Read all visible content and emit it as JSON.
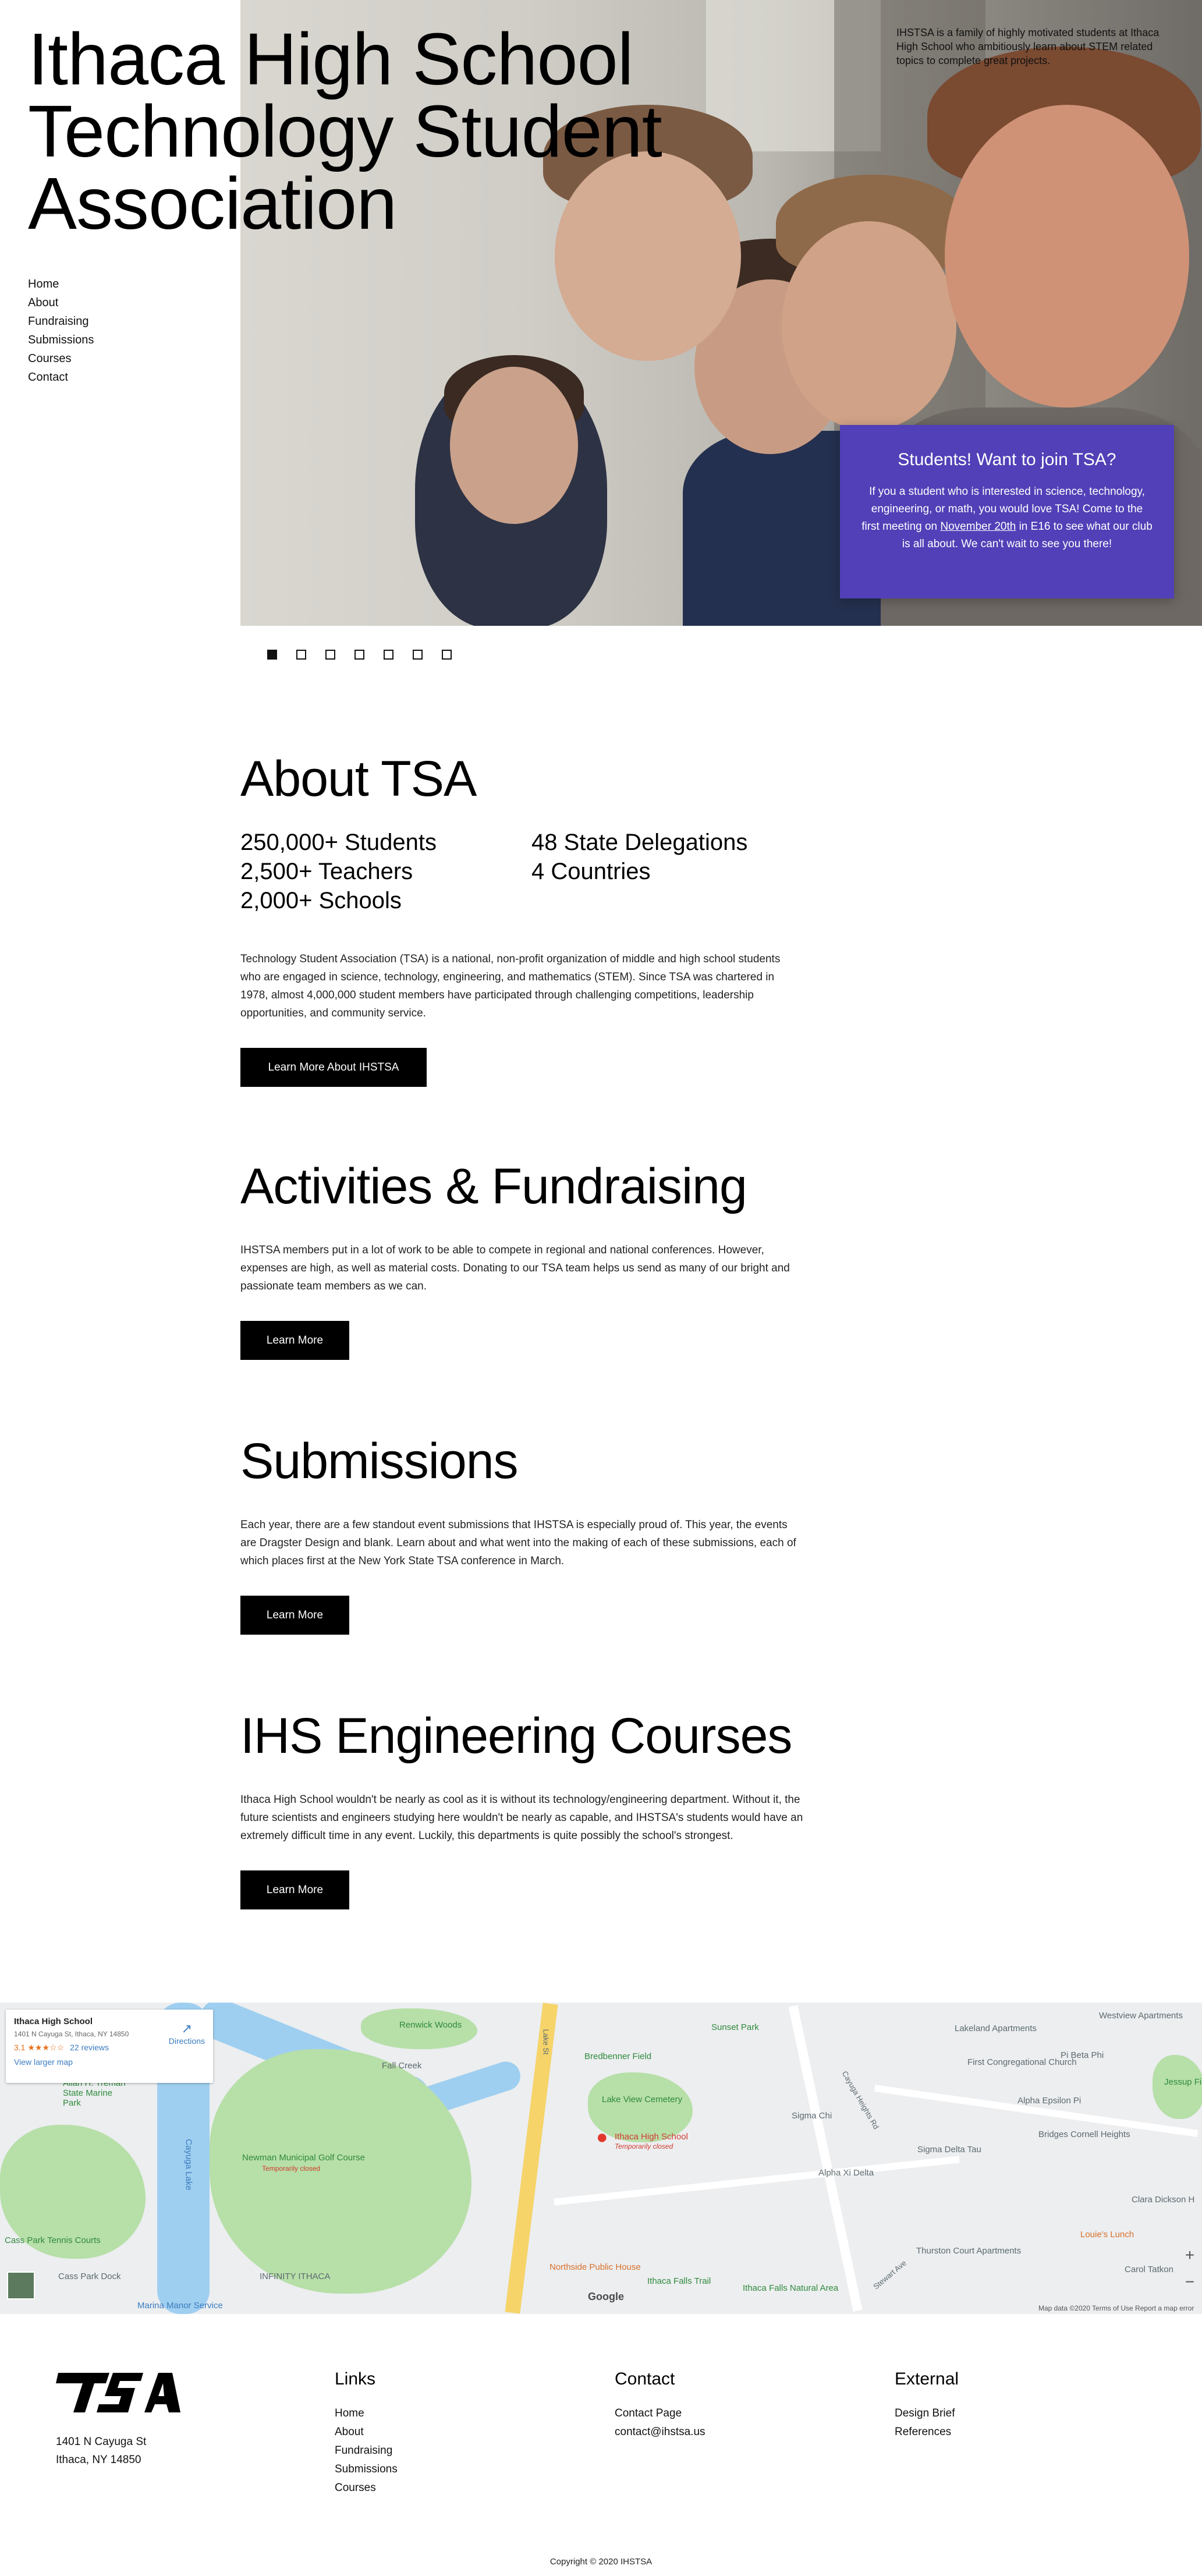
{
  "hero": {
    "title_line1": "Ithaca High School",
    "title_line2": "Technology Student",
    "title_line3": "Association",
    "blurb": "IHSTSA is a family of highly motivated students at Ithaca High School who ambitiously learn about STEM related topics to complete great projects.",
    "nav": [
      "Home",
      "About",
      "Fundraising",
      "Submissions",
      "Courses",
      "Contact"
    ],
    "join": {
      "heading": "Students! Want to join TSA?",
      "text_before": "If you a student who is interested in science, technology, engineering, or math, you would love TSA! Come to the first meeting on ",
      "text_link": "November 20th",
      "text_after": " in E16 to see what our club is all about. We can't wait to see you there!"
    },
    "slide_count": 7,
    "active_slide": 1
  },
  "about": {
    "title": "About TSA",
    "stats_left": [
      "250,000+ Students",
      "2,500+ Teachers",
      "2,000+ Schools"
    ],
    "stats_right": [
      "48 State Delegations",
      "4 Countries"
    ],
    "text": "Technology Student Association (TSA) is a national, non-profit organization of middle and high school students who are engaged in science, technology, engineering, and mathematics (STEM). Since TSA was chartered in 1978, almost 4,000,000 student members have participated through challenging competitions, leadership opportunities, and community service.",
    "button": "Learn More About IHSTSA"
  },
  "activities": {
    "title": "Activities & Fundraising",
    "text": "IHSTSA members put in a lot of work to be able to compete in regional and national conferences. However, expenses are high, as well as material costs. Donating to our TSA team helps us send as many of our bright and passionate team members as we can.",
    "button": "Learn More"
  },
  "submissions": {
    "title": "Submissions",
    "text": "Each year, there are a few standout event submissions that IHSTSA is especially proud of. This year, the events are Dragster Design and blank. Learn about and what went into the making of each of these submissions, each of which places first at the New York State TSA conference in March.",
    "button": "Learn More"
  },
  "courses": {
    "title": "IHS Engineering Courses",
    "text": "Ithaca High School wouldn't be nearly as cool as it is without its technology/engineering department. Without it, the future scientists and engineers studying here wouldn't be nearly as capable, and IHSTSA's students would have an extremely difficult time in any event. Luckily, this departments is quite possibly the school's strongest.",
    "button": "Learn More"
  },
  "map": {
    "card_name": "Ithaca High School",
    "card_address": "1401 N Cayuga St, Ithaca, NY 14850",
    "card_rating": "3.1",
    "card_stars": "★★★☆☆",
    "card_reviews": "22 reviews",
    "card_larger": "View larger map",
    "card_directions": "Directions",
    "pin_label": "Ithaca High School",
    "pin_sublabel": "Temporarily closed",
    "labels": {
      "renwick": "Renwick Woods",
      "sunset": "Sunset Park",
      "lakeland": "Lakeland Apartments",
      "westview": "Westview Apartments",
      "pibeta": "Pi Beta Phi",
      "jessup": "Jessup Field",
      "bredbenner": "Bredbenner Field",
      "lakeview": "Lake View Cemetery",
      "firstcong": "First Congregational Church",
      "alphaep": "Alpha Epsilon Pi",
      "sigmachi": "Sigma Chi",
      "sigmadelta": "Sigma Delta Tau",
      "bridges": "Bridges Cornell Heights",
      "alphaxi": "Alpha Xi Delta",
      "clara": "Clara Dickson H",
      "louie": "Louie's Lunch",
      "fallcreek": "Fall Creek",
      "cayuga": "Cayuga Lake",
      "stewart": "Allan H. Treman State Marine Park",
      "newman": "Newman Municipal Golf Course",
      "newman_sub": "Temporarily closed",
      "tennis": "Cass Park Tennis Courts",
      "dock": "Cass Park Dock",
      "infinity": "INFINITY ITHACA",
      "northside": "Northside Public House",
      "ithacafalls": "Ithaca Falls Trail",
      "fallsnat": "Ithaca Falls Natural Area",
      "thurston": "Thurston Court Apartments",
      "carol": "Carol Tatkon",
      "cayugaheights": "Cayuga Heights Rd",
      "stewartave": "Stewart Ave",
      "lakest": "Lake St",
      "marina": "Marina Manor Service"
    },
    "google": "Google",
    "attribution": "Map data ©2020   Terms of Use   Report a map error",
    "zoom_in": "+",
    "zoom_out": "−"
  },
  "footer": {
    "logo_text": "TSA",
    "address_line1": "1401 N Cayuga St",
    "address_line2": "Ithaca, NY 14850",
    "links_title": "Links",
    "links": [
      "Home",
      "About",
      "Fundraising",
      "Submissions",
      "Courses"
    ],
    "contact_title": "Contact",
    "contact": [
      "Contact Page",
      "contact@ihstsa.us"
    ],
    "external_title": "External",
    "external": [
      "Design Brief",
      "References"
    ],
    "copyright": "Copyright © 2020 IHSTSA"
  },
  "colors": {
    "join_box": "#5140b7",
    "button": "#000000",
    "map_park": "#b7dfa8",
    "map_water": "#9fcff0"
  }
}
